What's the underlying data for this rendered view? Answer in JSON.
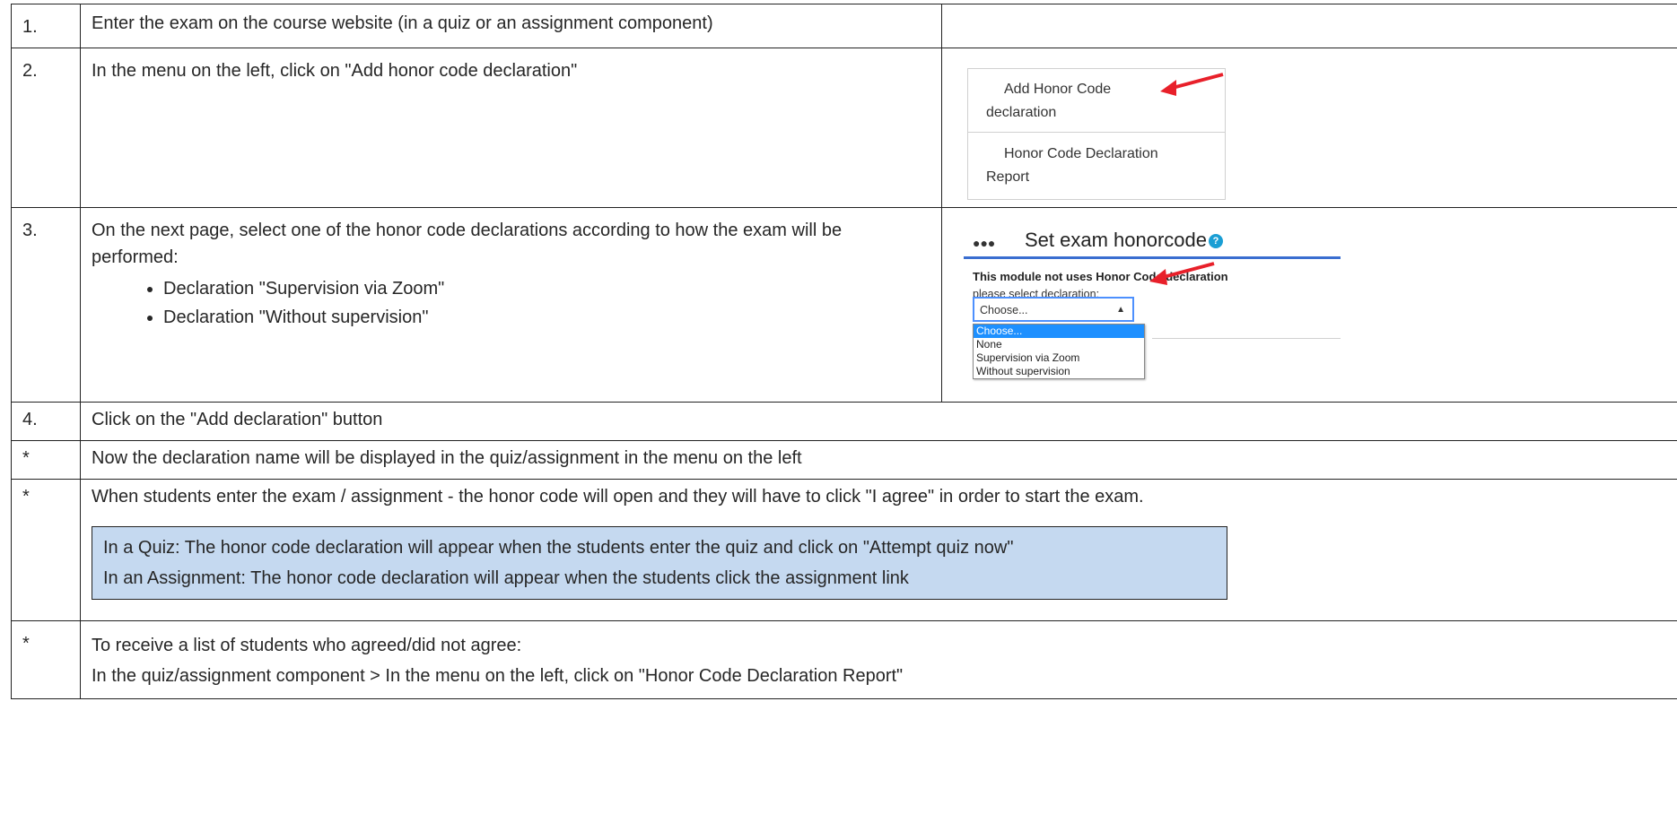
{
  "rows": [
    {
      "num": "1.",
      "text": "Enter the exam on the course website (in a quiz or an assignment component)"
    },
    {
      "num": "2.",
      "text": "In the menu on the left, click on \"Add honor code declaration\""
    },
    {
      "num": "3.",
      "text": "On the next page, select one of the honor code declarations according to how the exam will be performed:",
      "bullets": [
        "Declaration \"Supervision via Zoom\"",
        "Declaration \"Without supervision\""
      ]
    },
    {
      "num": "4.",
      "text": "Click on the \"Add declaration\" button"
    },
    {
      "num": "*",
      "text": "Now the declaration name will be displayed in the quiz/assignment in the menu on the left"
    },
    {
      "num": "*",
      "text": "When students enter the exam / assignment - the honor code will open and they will have to click \"I agree\" in order to start the exam.",
      "note": [
        "In a Quiz: The honor code declaration will appear when the students enter the quiz and click on \"Attempt quiz now\"",
        "In an Assignment: The honor code declaration will appear when the students click the assignment link"
      ]
    },
    {
      "num": "*",
      "text": "To receive a list of students who agreed/did not agree:",
      "text2": "In the quiz/assignment component > In the menu on the left, click on \"Honor Code Declaration Report\""
    }
  ],
  "menu_snippet": {
    "item1_line1": "Add Honor Code",
    "item1_line2": "declaration",
    "item2_line1": "Honor Code Declaration",
    "item2_line2": "Report"
  },
  "honorcode_snippet": {
    "title": "Set exam honorcode",
    "status": "This module not uses Honor Code declaration",
    "prompt": "please select declaration:",
    "selected": "Choose...",
    "options": [
      "Choose...",
      "None",
      "Supervision via Zoom",
      "Without supervision"
    ]
  },
  "colors": {
    "arrow": "#e8202a",
    "note_bg": "#c5d9f0",
    "accent": "#3a6ed0"
  }
}
